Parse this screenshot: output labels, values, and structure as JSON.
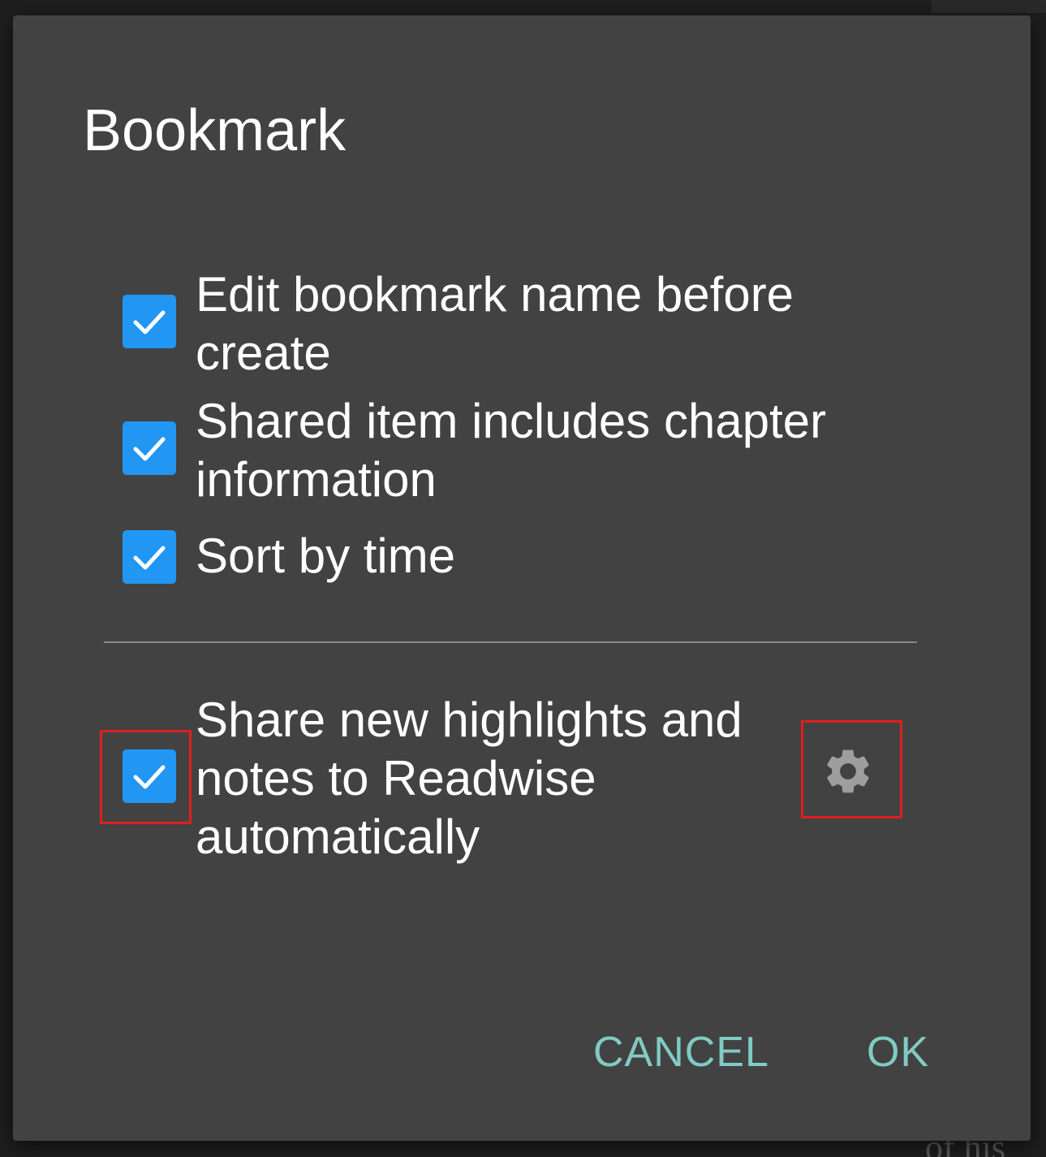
{
  "background": {
    "bottom_fragment": "of his"
  },
  "dialog": {
    "title": "Bookmark",
    "options": [
      {
        "label": "Edit bookmark name before create",
        "checked": true
      },
      {
        "label": "Shared item includes chapter information",
        "checked": true
      },
      {
        "label": "Sort by time",
        "checked": true
      }
    ],
    "readwise": {
      "label": "Share new highlights and notes to Readwise automatically",
      "checked": true,
      "settings_icon": "gear-icon"
    },
    "buttons": {
      "cancel": "CANCEL",
      "ok": "OK"
    }
  },
  "colors": {
    "dialog_bg": "#424242",
    "checkbox": "#2196f3",
    "action_text": "#80cbc4",
    "highlight": "#e01e1e",
    "gear": "#9e9e9e"
  }
}
